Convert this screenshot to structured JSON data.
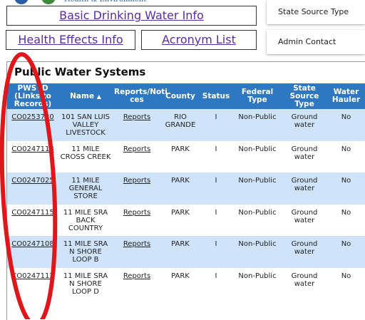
{
  "links": {
    "basic_water": "Basic Drinking Water Info",
    "health_effects": "Health Effects Info",
    "acronym_list": "Acronym List"
  },
  "side_panels": {
    "state_source_type": "State Source Type",
    "admin_contact": "Admin Contact"
  },
  "section_title": "Public Water Systems",
  "table": {
    "headers": {
      "pws_id": "PWS ID (Links to Records)",
      "name": "Name",
      "reports": "Reports/Noti ces",
      "county": "County",
      "status": "Status",
      "federal_type": "Federal Type",
      "state_source_type": "State Source Type",
      "water_hauler": "Water Hauler"
    },
    "sort_indicator": "▲",
    "rows": [
      {
        "id": "CO0253730",
        "name": "101 SAN LUIS VALLEY LIVESTOCK",
        "reports": "Reports",
        "county": "RIO GRANDE",
        "status": "I",
        "federal_type": "Non-Public",
        "source": "Ground water",
        "hauler": "No"
      },
      {
        "id": "CO0247118",
        "name": "11 MILE CROSS CREEK",
        "reports": "Reports",
        "county": "PARK",
        "status": "I",
        "federal_type": "Non-Public",
        "source": "Ground water",
        "hauler": "No"
      },
      {
        "id": "CO0247025",
        "name": "11 MILE GENERAL STORE",
        "reports": "Reports",
        "county": "PARK",
        "status": "I",
        "federal_type": "Non-Public",
        "source": "Ground water",
        "hauler": "No"
      },
      {
        "id": "CO0247115",
        "name": "11 MILE SRA BACK COUNTRY",
        "reports": "Reports",
        "county": "PARK",
        "status": "I",
        "federal_type": "Non-Public",
        "source": "Ground water",
        "hauler": "No"
      },
      {
        "id": "CO0247108",
        "name": "11 MILE SRA N SHORE LOOP B",
        "reports": "Reports",
        "county": "PARK",
        "status": "I",
        "federal_type": "Non-Public",
        "source": "Ground water",
        "hauler": "No"
      },
      {
        "id": "CO0247112",
        "name": "11 MILE SRA N SHORE LOOP D",
        "reports": "Reports",
        "county": "PARK",
        "status": "I",
        "federal_type": "Non-Public",
        "source": "Ground water",
        "hauler": "No"
      }
    ]
  },
  "colors": {
    "header_blue": "#2e78c2",
    "row_alt": "#cfe3fb",
    "link_purple": "#5a2ca0",
    "annotation_red": "#e0161b"
  }
}
